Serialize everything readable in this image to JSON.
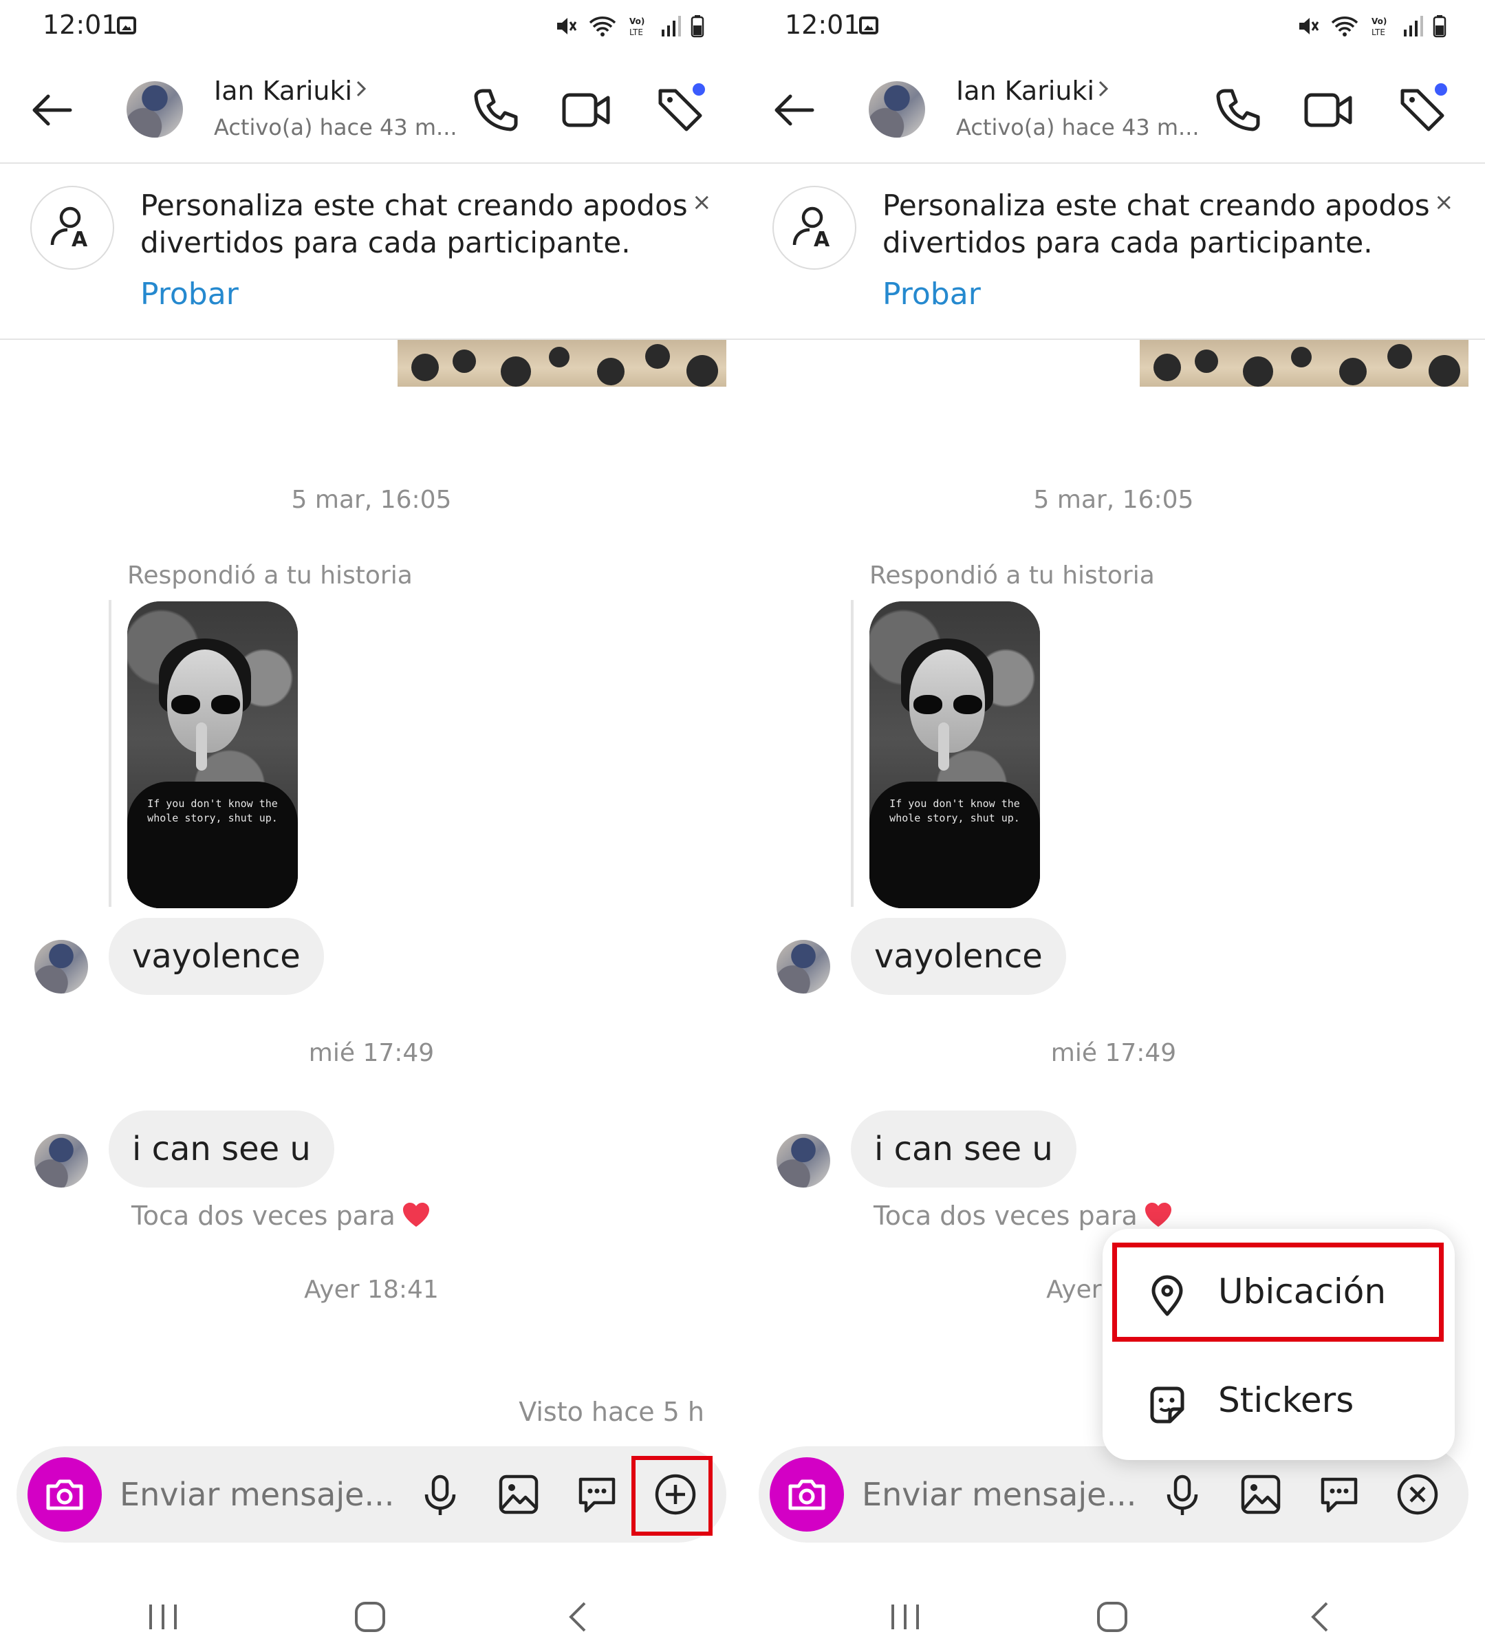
{
  "status_bar": {
    "time": "12:01"
  },
  "header": {
    "contact_name": "Ian Kariuki",
    "contact_status": "Activo(a) hace 43 m..."
  },
  "banner": {
    "text": "Personaliza este chat creando apodos divertidos para cada participante.",
    "close": "×",
    "action": "Probar"
  },
  "conversation": {
    "timestamp_1": "5 mar, 16:05",
    "replied_label": "Respondió a tu historia",
    "story_caption": "If you don't know the whole story, shut up.",
    "message_1": "vayolence",
    "timestamp_2": "mié 17:49",
    "message_2": "i can see u",
    "double_tap_hint": "Toca dos veces para",
    "timestamp_3": "Ayer 18:41",
    "seen": "Visto hace 5 h"
  },
  "composer": {
    "placeholder": "Enviar mensaje..."
  },
  "popup_menu": {
    "items": [
      {
        "label": "Ubicación",
        "icon": "location-pin-icon"
      },
      {
        "label": "Stickers",
        "icon": "sticker-icon"
      }
    ]
  },
  "colors": {
    "camera_button": "#d300c5",
    "link": "#2589cf",
    "highlight": "#e0000f",
    "bubble": "#efefef",
    "notification_dot": "#3b5bfd"
  }
}
